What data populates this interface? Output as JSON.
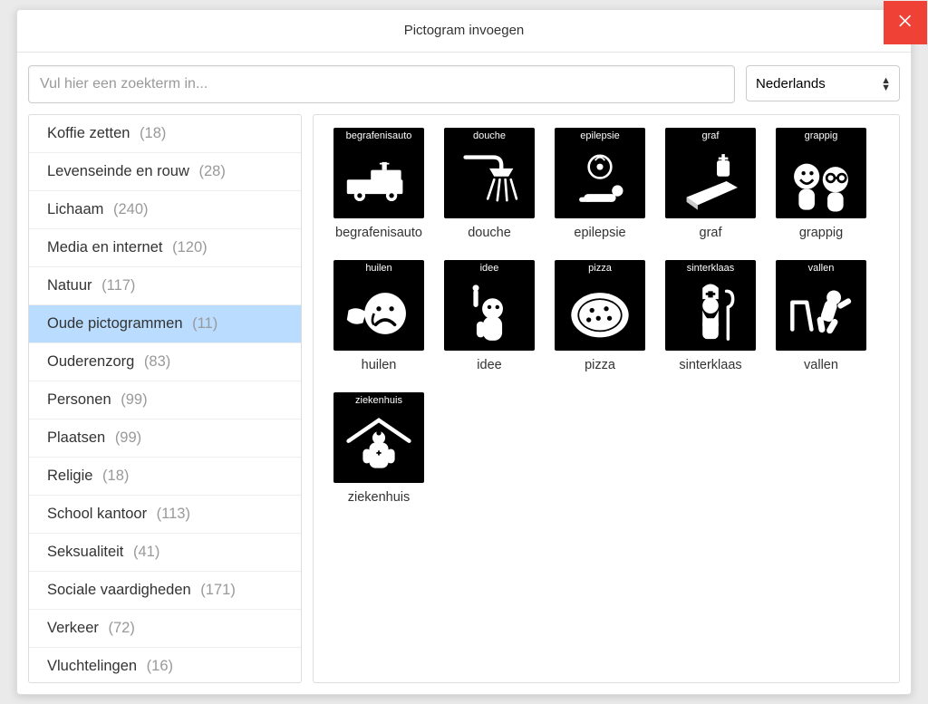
{
  "header": {
    "title": "Pictogram invoegen"
  },
  "search": {
    "placeholder": "Vul hier een zoekterm in..."
  },
  "language": {
    "selected": "Nederlands",
    "options": [
      "Nederlands"
    ]
  },
  "categories": [
    {
      "label": "Koffie zetten",
      "count": "(18)",
      "selected": false
    },
    {
      "label": "Levenseinde en rouw",
      "count": "(28)",
      "selected": false
    },
    {
      "label": "Lichaam",
      "count": "(240)",
      "selected": false
    },
    {
      "label": "Media en internet",
      "count": "(120)",
      "selected": false
    },
    {
      "label": "Natuur",
      "count": "(117)",
      "selected": false
    },
    {
      "label": "Oude pictogrammen",
      "count": "(11)",
      "selected": true
    },
    {
      "label": "Ouderenzorg",
      "count": "(83)",
      "selected": false
    },
    {
      "label": "Personen",
      "count": "(99)",
      "selected": false
    },
    {
      "label": "Plaatsen",
      "count": "(99)",
      "selected": false
    },
    {
      "label": "Religie",
      "count": "(18)",
      "selected": false
    },
    {
      "label": "School kantoor",
      "count": "(113)",
      "selected": false
    },
    {
      "label": "Seksualiteit",
      "count": "(41)",
      "selected": false
    },
    {
      "label": "Sociale vaardigheden",
      "count": "(171)",
      "selected": false
    },
    {
      "label": "Verkeer",
      "count": "(72)",
      "selected": false
    },
    {
      "label": "Vluchtelingen",
      "count": "(16)",
      "selected": false
    }
  ],
  "pictograms": [
    {
      "key": "begrafenisauto",
      "label": "begrafenisauto"
    },
    {
      "key": "douche",
      "label": "douche"
    },
    {
      "key": "epilepsie",
      "label": "epilepsie"
    },
    {
      "key": "graf",
      "label": "graf"
    },
    {
      "key": "grappig",
      "label": "grappig"
    },
    {
      "key": "huilen",
      "label": "huilen"
    },
    {
      "key": "idee",
      "label": "idee"
    },
    {
      "key": "pizza",
      "label": "pizza"
    },
    {
      "key": "sinterklaas",
      "label": "sinterklaas"
    },
    {
      "key": "vallen",
      "label": "vallen"
    },
    {
      "key": "ziekenhuis",
      "label": "ziekenhuis"
    }
  ]
}
